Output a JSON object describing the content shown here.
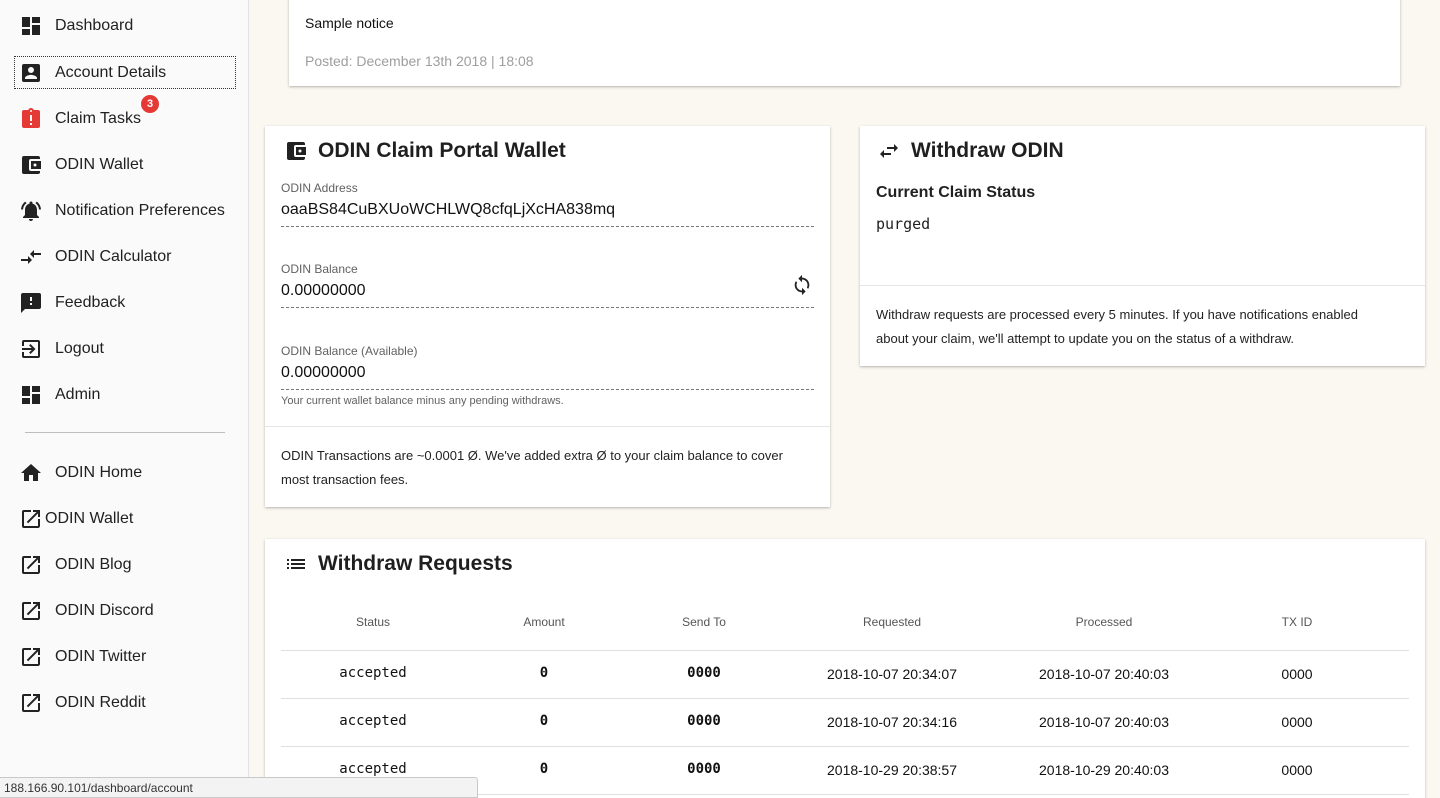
{
  "sidebar": {
    "items": [
      {
        "label": "Dashboard",
        "icon": "dashboard-icon"
      },
      {
        "label": "Account Details",
        "icon": "account-box-icon"
      },
      {
        "label": "Claim Tasks",
        "icon": "clipboard-alert-icon",
        "badge": "3"
      },
      {
        "label": "ODIN Wallet",
        "icon": "wallet-icon"
      },
      {
        "label": "Notification Preferences",
        "icon": "bell-ring-icon"
      },
      {
        "label": "ODIN Calculator",
        "icon": "compare-arrows-icon"
      },
      {
        "label": "Feedback",
        "icon": "feedback-icon"
      },
      {
        "label": "Logout",
        "icon": "exit-icon"
      },
      {
        "label": "Admin",
        "icon": "dashboard-icon"
      }
    ],
    "links": [
      {
        "label": "ODIN Home",
        "icon": "home-icon"
      },
      {
        "label": "ODIN Wallet",
        "icon": "external-link-icon"
      },
      {
        "label": "ODIN Blog",
        "icon": "external-link-icon"
      },
      {
        "label": "ODIN Discord",
        "icon": "external-link-icon"
      },
      {
        "label": "ODIN Twitter",
        "icon": "external-link-icon"
      },
      {
        "label": "ODIN Reddit",
        "icon": "external-link-icon"
      }
    ]
  },
  "notice": {
    "text": "Sample notice",
    "posted": "Posted: December 13th 2018 | 18:08"
  },
  "wallet": {
    "title": "ODIN Claim Portal Wallet",
    "address_label": "ODIN Address",
    "address": "oaaBS84CuBXUoWCHLWQ8cfqLjXcHA838mq",
    "balance_label": "ODIN Balance",
    "balance": "0.00000000",
    "available_label": "ODIN Balance (Available)",
    "available": "0.00000000",
    "available_hint": "Your current wallet balance minus any pending withdraws.",
    "footer_line1": "ODIN Transactions are ~0.0001 Ø. We've added extra Ø to your claim balance to cover",
    "footer_line2": "most transaction fees."
  },
  "withdraw": {
    "title": "Withdraw ODIN",
    "status_heading": "Current Claim Status",
    "status": "purged",
    "footer_line1": "Withdraw requests are processed every 5 minutes. If you have notifications enabled",
    "footer_line2": "about your claim, we'll attempt to update you on the status of a withdraw."
  },
  "requests": {
    "title": "Withdraw Requests",
    "columns": [
      "Status",
      "Amount",
      "Send To",
      "Requested",
      "Processed",
      "TX ID"
    ],
    "rows": [
      [
        "accepted",
        "0",
        "0000",
        "2018-10-07 20:34:07",
        "2018-10-07 20:40:03",
        "0000"
      ],
      [
        "accepted",
        "0",
        "0000",
        "2018-10-07 20:34:16",
        "2018-10-07 20:40:03",
        "0000"
      ],
      [
        "accepted",
        "0",
        "0000",
        "2018-10-29 20:38:57",
        "2018-10-29 20:40:03",
        "0000"
      ]
    ]
  },
  "status_bar": {
    "url": "188.166.90.101/dashboard/account"
  },
  "colors": {
    "background": "#fbf8f1",
    "badge": "#e53935",
    "alert_icon": "#e53935"
  }
}
